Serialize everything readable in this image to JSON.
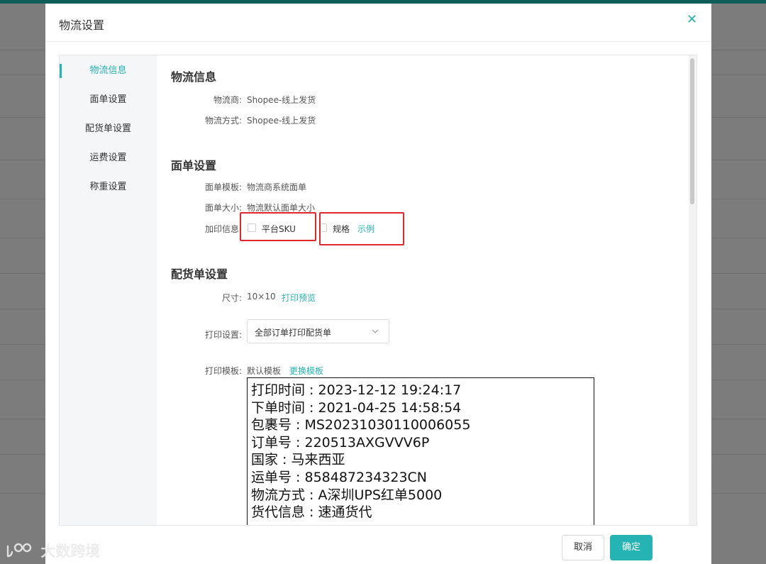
{
  "modal": {
    "title": "物流设置",
    "close_icon": "close-icon"
  },
  "nav": {
    "items": [
      {
        "label": "物流信息",
        "active": true
      },
      {
        "label": "面单设置",
        "active": false
      },
      {
        "label": "配货单设置",
        "active": false
      },
      {
        "label": "运费设置",
        "active": false
      },
      {
        "label": "称重设置",
        "active": false
      }
    ]
  },
  "logistics_info": {
    "title": "物流信息",
    "carrier_label": "物流商:",
    "carrier_value": "Shopee-线上发货",
    "method_label": "物流方式:",
    "method_value": "Shopee-线上发货"
  },
  "label_settings": {
    "title": "面单设置",
    "template_label": "面单模板:",
    "template_value": "物流商系统面单",
    "size_label": "面单大小:",
    "size_value": "物流默认面单大小",
    "extra_label": "加印信息:",
    "option_sku": "平台SKU",
    "option_sku_checked": false,
    "option_spec": "规格",
    "option_spec_checked": false,
    "example_link": "示例"
  },
  "packing_settings": {
    "title": "配货单设置",
    "size_label": "尺寸:",
    "size_value": "10×10",
    "preview_link": "打印预览",
    "print_label": "打印设置:",
    "print_value": "全部订单打印配货单",
    "template_label": "打印模板:",
    "template_value": "默认模板",
    "change_template_link": "更换模板"
  },
  "preview": {
    "lines": [
      "打印时间 : 2023-12-12 19:24:17",
      "下单时间 : 2021-04-25 14:58:54",
      "包裹号 : MS20231030110006055",
      "订单号 : 220513AXGVVV6P",
      "国家 : 马来西亚",
      "运单号 : 858487234323CN",
      "物流方式 : A深圳UPS红单5000",
      "货代信息 : 速通货代"
    ]
  },
  "footer": {
    "cancel_label": "取消",
    "ok_label": "确定"
  },
  "watermark": {
    "text": "大数跨境"
  },
  "colors": {
    "accent": "#26b3b3",
    "highlight": "#e0272c",
    "header_bar": "#0f5d58"
  }
}
